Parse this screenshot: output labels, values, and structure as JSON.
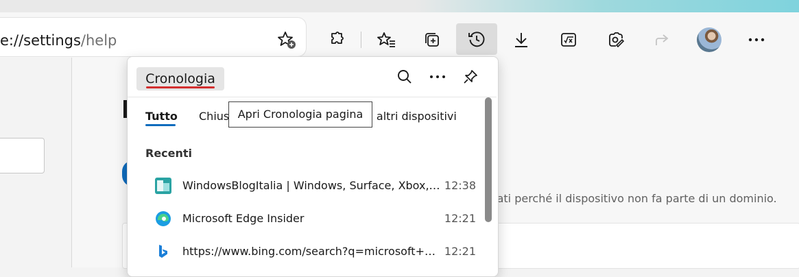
{
  "address": {
    "prefix": "e://",
    "path_main": "settings",
    "path_sep": "/",
    "path_sub": "help"
  },
  "toolbar": {
    "icons": [
      "add-favorite-icon",
      "extensions-icon",
      "favorites-icon",
      "collections-icon",
      "history-icon",
      "downloads-icon",
      "math-solver-icon",
      "web-capture-icon",
      "share-icon",
      "avatar",
      "more-icon"
    ]
  },
  "page": {
    "notice": "rati perché il dispositivo non fa parte di un dominio."
  },
  "history": {
    "title": "Cronologia",
    "tabs": {
      "all": "Tutto",
      "closed": "Chius",
      "other": "a altri dispositivi"
    },
    "section": "Recenti",
    "items": [
      {
        "title": "WindowsBlogItalia | Windows, Surface, Xbox, ...",
        "time": "12:38",
        "icon": "windowsblogitalia-favicon"
      },
      {
        "title": "Microsoft Edge Insider",
        "time": "12:21",
        "icon": "edge-favicon"
      },
      {
        "title": "https://www.bing.com/search?q=microsoft+e...",
        "time": "12:21",
        "icon": "bing-favicon"
      }
    ]
  },
  "tooltip": "Apri Cronologia pagina",
  "colors": {
    "accent": "#0f6cbd",
    "title_underline": "#d32f2f",
    "active_button": "#dcdcdc"
  }
}
